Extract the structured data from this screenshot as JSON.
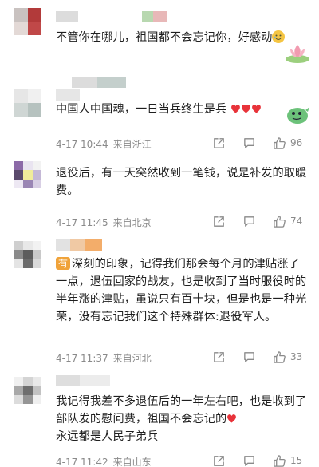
{
  "colors": {
    "accent_heart": "#e8333a",
    "meta_gray": "#8a8a8a",
    "text": "#1f1f1f",
    "badge_orange": "#f0a33a"
  },
  "comments": [
    {
      "text": "不管你在哪儿，祖国都不会忘记你，好感动",
      "has_emoji": "tearful-smile-emoji",
      "sticker": "lotus-flower-sticker"
    },
    {
      "text": "中国人中国魂，一日当兵终生是兵",
      "hearts": 3,
      "sticker": "dinosaur-sticker",
      "date": "4-17 10:44",
      "location": "来自浙江",
      "likes": "96"
    },
    {
      "text": "退役后，有一天突然收到一笔钱，说是补发的取暖费。",
      "date": "4-17 11:45",
      "location": "来自北京",
      "likes": "74"
    },
    {
      "badge": "有",
      "text": "深刻的印象，记得我们那会每个月的津贴涨了一点，退伍回家的战友，也是收到了当时服役时的半年涨的津贴，虽说只有百十块，但是也是一种光荣，没有忘记我们这个特殊群体:退役军人。",
      "date": "4-17 11:37",
      "location": "来自河北",
      "likes": "33"
    },
    {
      "text_a": "我记得我差不多退伍后的一年左右吧，也是收到了部队发的慰问费，祖国不会忘记的",
      "text_b": "永远都是人民子弟兵",
      "hearts": 1,
      "date": "4-17 11:42",
      "location": "来自山东",
      "likes": "15"
    }
  ]
}
